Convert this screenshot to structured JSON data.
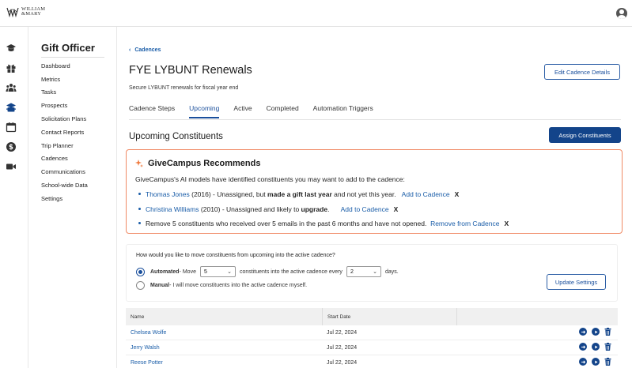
{
  "brand": {
    "logo_line1": "WILLIAM",
    "logo_line2": "&MARY"
  },
  "sidebar": {
    "title": "Gift Officer",
    "items": [
      "Dashboard",
      "Metrics",
      "Tasks",
      "Prospects",
      "Solicitation Plans",
      "Contact Reports",
      "Trip Planner",
      "Cadences",
      "Communications",
      "School-wide Data",
      "Settings"
    ]
  },
  "breadcrumb": {
    "label": "Cadences"
  },
  "page": {
    "title": "FYE LYBUNT Renewals",
    "subtitle": "Secure LYBUNT renewals for fiscal year end",
    "edit_button": "Edit Cadence Details"
  },
  "tabs": [
    {
      "label": "Cadence Steps",
      "active": false
    },
    {
      "label": "Upcoming",
      "active": true
    },
    {
      "label": "Active",
      "active": false
    },
    {
      "label": "Completed",
      "active": false
    },
    {
      "label": "Automation Triggers",
      "active": false
    }
  ],
  "section": {
    "title": "Upcoming Constituents",
    "assign_button": "Assign Constituents"
  },
  "recommend": {
    "title": "GiveCampus Recommends",
    "intro": "GiveCampus's AI models have identified constituents you may want to add to the cadence:",
    "items": [
      {
        "name": "Thomas Jones",
        "rest_a": " (2016) - Unassigned, but ",
        "bold": "made a gift last year",
        "rest_b": " and not yet this year.",
        "action": "Add to Cadence",
        "dismiss": "X"
      },
      {
        "name": "Christina Williams",
        "rest_a": " (2010) - Unassigned and likely to ",
        "bold": "upgrade",
        "rest_b": ".",
        "action": "Add to Cadence",
        "dismiss": "X"
      },
      {
        "text": "Remove 5 constituents who received over 5 emails in the past 6 months and have not opened.",
        "action": "Remove from Cadence",
        "dismiss": "X"
      }
    ]
  },
  "settings": {
    "question": "How would you like to move constituents from upcoming into the active cadence?",
    "automated_label": "Automated",
    "automated_a": " - Move",
    "count_value": "5",
    "automated_b": "constituents into the active cadence every",
    "every_value": "2",
    "automated_c": "days.",
    "manual_label": "Manual",
    "manual_text": " - I will move constituents into the active cadence myself.",
    "update_button": "Update Settings",
    "selected": "automated"
  },
  "table": {
    "columns": [
      "Name",
      "Start Date",
      ""
    ],
    "rows": [
      {
        "name": "Chelsea Wolfe",
        "date": "Jul 22, 2024"
      },
      {
        "name": "Jerry Walsh",
        "date": "Jul 22, 2024"
      },
      {
        "name": "Reese Potter",
        "date": "Jul 22, 2024"
      }
    ]
  },
  "colors": {
    "primary": "#13448a",
    "link": "#1a5da8",
    "recommend_border": "#f08a65",
    "spark": "#f07b3f"
  }
}
